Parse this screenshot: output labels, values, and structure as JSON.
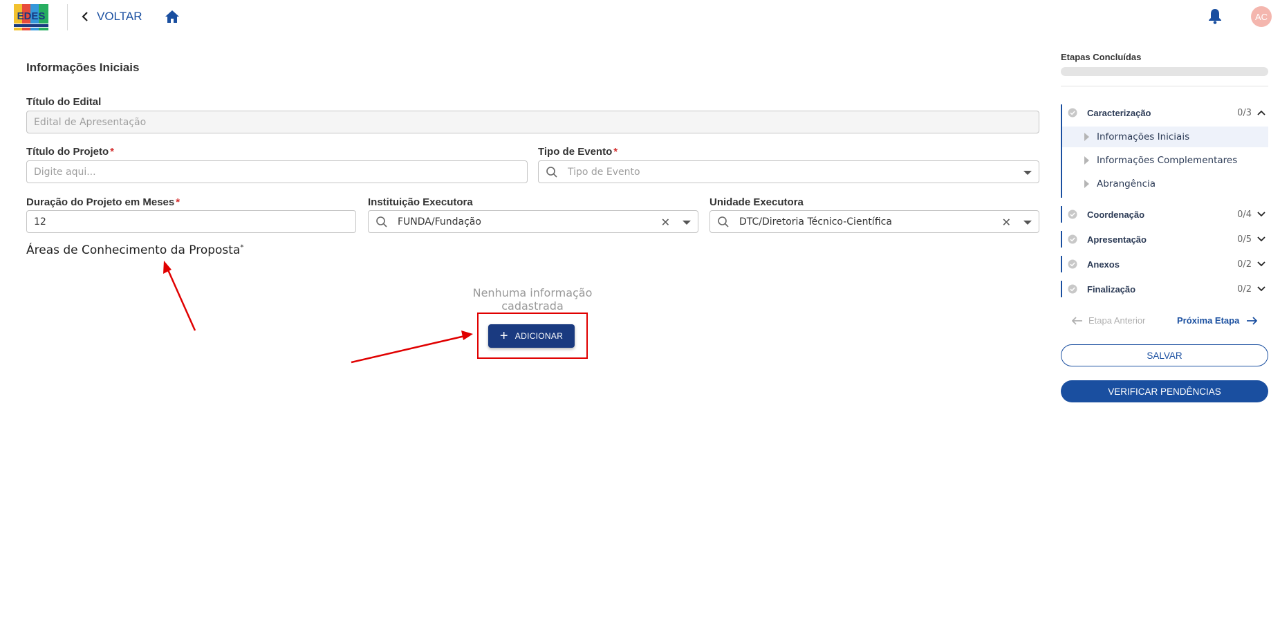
{
  "header": {
    "back_label": "VOLTAR",
    "avatar_initials": "AC",
    "logo_icon": "institution-logo",
    "brand_color": "#1a4fa0"
  },
  "form": {
    "section_title": "Informações Iniciais",
    "titulo_edital": {
      "label": "Título do Edital",
      "value": "Edital de Apresentação"
    },
    "titulo_projeto": {
      "label": "Título do Projeto",
      "required_mark": "*",
      "placeholder": "Digite aqui..."
    },
    "tipo_evento": {
      "label": "Tipo de Evento",
      "required_mark": "*",
      "placeholder": "Tipo de Evento"
    },
    "duracao": {
      "label": "Duração do Projeto em Meses",
      "required_mark": "*",
      "value": "12"
    },
    "instituicao": {
      "label": "Instituição Executora",
      "value": "FUNDA/Fundação"
    },
    "unidade": {
      "label": "Unidade Executora",
      "value": "DTC/Diretoria Técnico-Científica"
    },
    "areas": {
      "title": "Áreas de Conhecimento da Proposta",
      "required_mark": "*",
      "empty_message": "Nenhuma informação cadastrada",
      "add_button": "ADICIONAR"
    }
  },
  "sidebar": {
    "progress_label": "Etapas Concluídas",
    "progress_fraction": 0,
    "stages": [
      {
        "name": "Caracterização",
        "count": "0/3",
        "expanded": true,
        "substeps": [
          "Informações Iniciais",
          "Informações Complementares",
          "Abrangência"
        ]
      },
      {
        "name": "Coordenação",
        "count": "0/4",
        "expanded": false
      },
      {
        "name": "Apresentação",
        "count": "0/5",
        "expanded": false
      },
      {
        "name": "Anexos",
        "count": "0/2",
        "expanded": false
      },
      {
        "name": "Finalização",
        "count": "0/2",
        "expanded": false
      }
    ],
    "prev_label": "Etapa Anterior",
    "next_label": "Próxima Etapa",
    "save_label": "SALVAR",
    "verify_label": "VERIFICAR PENDÊNCIAS"
  },
  "colors": {
    "primary": "#1a4fa0",
    "button_dark": "#1a3a80",
    "required": "#d32f2f",
    "annotation": "#e00000",
    "avatar": "#f4b6ae"
  }
}
